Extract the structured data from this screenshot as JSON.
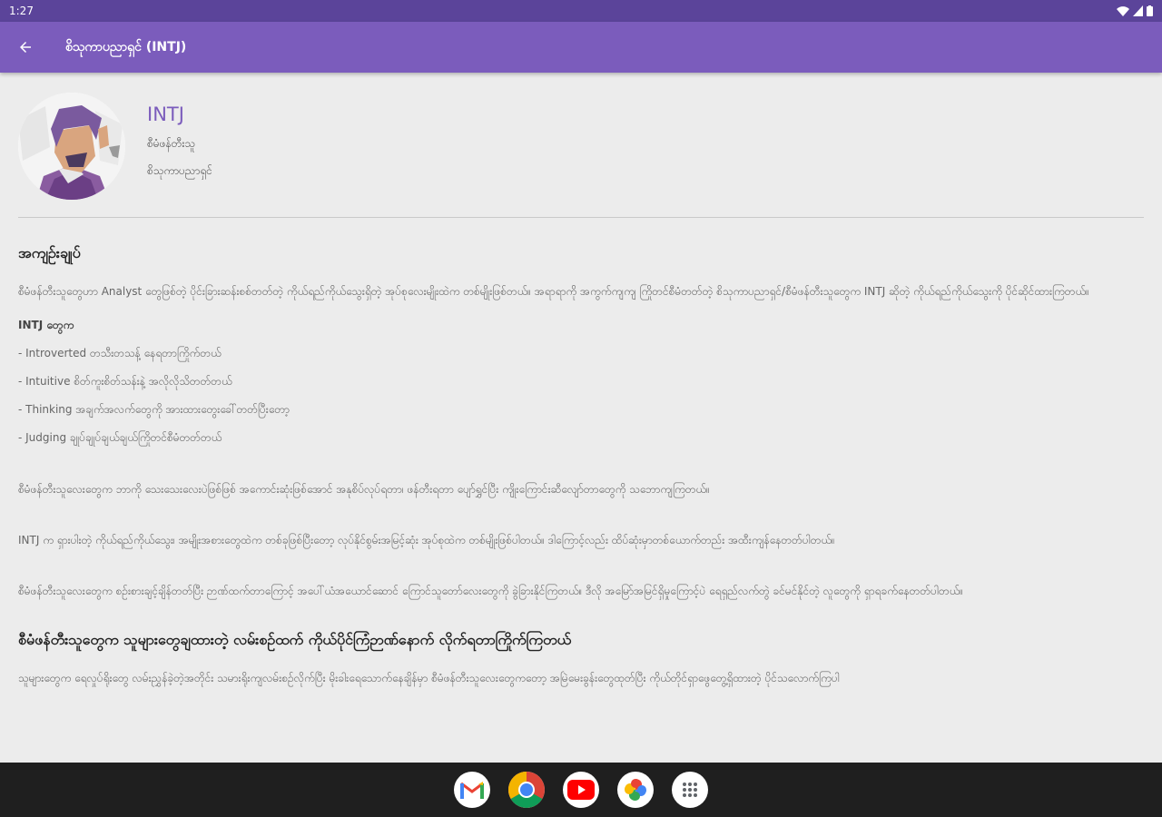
{
  "status_bar": {
    "time": "1:27"
  },
  "app_bar": {
    "title": "စိသုကာပညာရှင် (INTJ)"
  },
  "profile": {
    "code": "INTJ",
    "subtitle1": "စီမံဖန်တီးသူ",
    "subtitle2": "စိသုကာပညာရှင်"
  },
  "article": {
    "section1_title": "အကျဉ်းချုပ်",
    "para1": "စီမံဖန်တီးသူတွေဟာ Analyst တွေဖြစ်တဲ့ ပိုင်းခြားဆန်းစစ်တတ်တဲ့ ကိုယ်ရည်ကိုယ်သွေးရှိတဲ့ အုပ်စုလေးမျိုးထဲက တစ်မျိုးဖြစ်တယ်။ အရာရာကို အကွက်ကျကျ ကြိုတင်စီမံတတ်တဲ့ စိသုကာပညာရှင်/စီမံဖန်တီးသူတွေက INTJ ဆိုတဲ့ ကိုယ်ရည်ကိုယ်သွေးကို ပိုင်ဆိုင်ထားကြတယ်။",
    "intj_heading": "INTJ တွေက",
    "traits": [
      "- Introverted တသီးတသန့် နေရတာကြိုက်တယ်",
      "- Intuitive စိတ်ကူးစိတ်သန်းနဲ့ အလိုလိုသိတတ်တယ်",
      "- Thinking အချက်အလက်တွေကို အားထားတွေးခေါ်တတ်ပြီးတော့",
      "- Judging ချုပ်ချုပ်ချယ်ချယ်ကြိုတင်စီမံတတ်တယ်"
    ],
    "para2": "စီမံဖန်တီးသူလေးတွေက ဘာကို သေးသေးလေးပဲဖြစ်ဖြစ် အကောင်းဆုံးဖြစ်အောင် အနုစိပ်လုပ်ရတာ၊ ဖန်တီးရတာ ပျော်ရွှင်ပြီး ကျိုးကြောင်းဆီလျော်တာတွေကို သဘောကျကြတယ်။",
    "para3": "INTJ က ရှားပါးတဲ့ ကိုယ်ရည်ကိုယ်သွေး၊ အမျိုးအစားတွေထဲက တစ်ခုဖြစ်ပြီးတော့ လုပ်နိုင်စွမ်းအမြင့်ဆုံး အုပ်စုထဲက တစ်မျိုးဖြစ်ပါတယ်။ ဒါကြောင့်လည်း ထိပ်ဆုံးမှာတစ်ယောက်တည်း အထီးကျန်နေတတ်ပါတယ်။",
    "para4": "စီမံဖန်တီးသူလေးတွေက စဉ်းစားချင့်ချိန်တတ်ပြီး ဉာဏ်ထက်တာကြောင့် အပေါ်ယံအယောင်ဆောင် ကြောင်သူတော်လေးတွေကို ခွဲခြားနိုင်ကြတယ်။ ဒီလို အမြော်အမြင်ရှိမှုကြောင့်ပဲ ရေရှည်လက်တွဲ ခင်မင်နိုင်တဲ့ လူတွေကို ရှာရခက်နေတတ်ပါတယ်။",
    "section2_title": "စီမံဖန်တီးသူတွေက သူများတွေချထားတဲ့ လမ်းစဉ်ထက် ကိုယ်ပိုင်ကြံဉာဏ်နောက် လိုက်ရတာကြိုက်ကြတယ်",
    "para5": "သူများတွေက ရေလှုပ်ရိုးတွေ လမ်းညွှန်ခဲ့တဲ့အတိုင်း သမားရိုးကျလမ်းစဉ်လိုက်ပြီး မိုးခါးရေသောက်နေချိန်မှာ စီမံဖန်တီးသူလေးတွေကတော့ အမြဲမေးခွန်းတွေထုတ်ပြီး ကိုယ်တိုင်ရှာဖွေတွေ့ရှိထားတဲ့ ပိုင်သလောက်ကြပါ"
  },
  "dock": {
    "apps": [
      "gmail-icon",
      "chrome-icon",
      "youtube-icon",
      "photos-icon",
      "app-drawer-icon"
    ]
  }
}
